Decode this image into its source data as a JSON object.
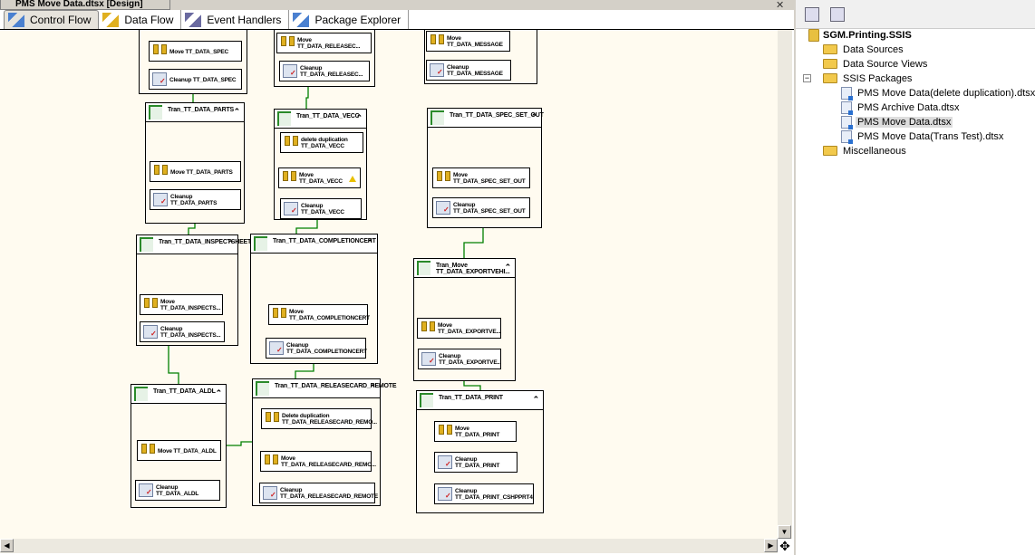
{
  "document_tab": "PMS Move Data.dtsx [Design]",
  "tabs": [
    {
      "label": "Control Flow",
      "icon": "control-flow-icon",
      "active": true
    },
    {
      "label": "Data Flow",
      "icon": "data-flow-icon",
      "active": false
    },
    {
      "label": "Event Handlers",
      "icon": "event-handlers-icon",
      "active": false
    },
    {
      "label": "Package Explorer",
      "icon": "package-explorer-icon",
      "active": false
    }
  ],
  "containers": [
    {
      "title": "",
      "tasks": [
        {
          "l1": "Move TT_DATA_SPEC",
          "l2": "",
          "type": "move"
        },
        {
          "l1": "Cleanup TT_DATA_SPEC",
          "l2": "",
          "type": "clean"
        }
      ]
    },
    {
      "title": "",
      "tasks": [
        {
          "l1": "Move",
          "l2": "TT_DATA_RELEASEC...",
          "type": "move"
        },
        {
          "l1": "Cleanup",
          "l2": "TT_DATA_RELEASEC...",
          "type": "clean"
        }
      ]
    },
    {
      "title": "",
      "tasks": [
        {
          "l1": "Move",
          "l2": "TT_DATA_MESSAGE",
          "type": "move"
        },
        {
          "l1": "Cleanup",
          "l2": "TT_DATA_MESSAGE",
          "type": "clean"
        }
      ]
    },
    {
      "title": "Tran_TT_DATA_PARTS",
      "tasks": [
        {
          "l1": "Move TT_DATA_PARTS",
          "l2": "",
          "type": "move"
        },
        {
          "l1": "Cleanup",
          "l2": "TT_DATA_PARTS",
          "type": "clean"
        }
      ]
    },
    {
      "title": "Tran_TT_DATA_VECC",
      "tasks": [
        {
          "l1": "delete duplication",
          "l2": "TT_DATA_VECC",
          "type": "move"
        },
        {
          "l1": "Move",
          "l2": "TT_DATA_VECC",
          "type": "move",
          "warning": true
        },
        {
          "l1": "Cleanup",
          "l2": "TT_DATA_VECC",
          "type": "clean"
        }
      ]
    },
    {
      "title": "Tran_TT_DATA_SPEC_SET_OUT",
      "tasks": [
        {
          "l1": "Move",
          "l2": "TT_DATA_SPEC_SET_OUT",
          "type": "move"
        },
        {
          "l1": "Cleanup",
          "l2": "TT_DATA_SPEC_SET_OUT",
          "type": "clean"
        }
      ]
    },
    {
      "title": "Tran_TT_DATA_INSPECTSHEET",
      "tasks": [
        {
          "l1": "Move",
          "l2": "TT_DATA_INSPECTS...",
          "type": "move"
        },
        {
          "l1": "Cleanup",
          "l2": "TT_DATA_INSPECTS...",
          "type": "clean"
        }
      ]
    },
    {
      "title": "Tran_TT_DATA_COMPLETIONCERT",
      "tasks": [
        {
          "l1": "Move",
          "l2": "TT_DATA_COMPLETIONCERT",
          "type": "move"
        },
        {
          "l1": "Cleanup",
          "l2": "TT_DATA_COMPLETIONCERT",
          "type": "clean"
        }
      ]
    },
    {
      "title": "Tran_Move TT_DATA_EXPORTVEHI...",
      "tasks": [
        {
          "l1": "Move",
          "l2": "TT_DATA_EXPORTVE...",
          "type": "move"
        },
        {
          "l1": "Cleanup",
          "l2": "TT_DATA_EXPORTVE...",
          "type": "clean"
        }
      ]
    },
    {
      "title": "Tran_TT_DATA_ALDL",
      "tasks": [
        {
          "l1": "Move TT_DATA_ALDL",
          "l2": "",
          "type": "move"
        },
        {
          "l1": "Cleanup",
          "l2": "TT_DATA_ALDL",
          "type": "clean"
        }
      ]
    },
    {
      "title": "Tran_TT_DATA_RELEASECARD_REMOTE",
      "tasks": [
        {
          "l1": "Delete duplication",
          "l2": "TT_DATA_RELEASECARD_REMO...",
          "type": "move"
        },
        {
          "l1": "Move",
          "l2": "TT_DATA_RELEASECARD_REMO...",
          "type": "move"
        },
        {
          "l1": "Cleanup",
          "l2": "TT_DATA_RELEASECARD_REMOTE",
          "type": "clean"
        }
      ]
    },
    {
      "title": "Tran_TT_DATA_PRINT",
      "tasks": [
        {
          "l1": "Move",
          "l2": "TT_DATA_PRINT",
          "type": "move"
        },
        {
          "l1": "Cleanup",
          "l2": "TT_DATA_PRINT",
          "type": "clean"
        },
        {
          "l1": "Cleanup",
          "l2": "TT_DATA_PRINT_CSHPPRT4",
          "type": "clean"
        }
      ]
    }
  ],
  "solution": {
    "project": "SGM.Printing.SSIS",
    "items": [
      {
        "label": "Data Sources",
        "kind": "folder"
      },
      {
        "label": "Data Source Views",
        "kind": "folder"
      },
      {
        "label": "SSIS Packages",
        "kind": "folder",
        "expanded": true
      },
      {
        "label": "PMS Move Data(delete duplication).dtsx",
        "kind": "package"
      },
      {
        "label": "PMS Archive Data.dtsx",
        "kind": "package"
      },
      {
        "label": "PMS Move Data.dtsx",
        "kind": "package",
        "selected": true
      },
      {
        "label": "PMS Move Data(Trans Test).dtsx",
        "kind": "package"
      },
      {
        "label": "Miscellaneous",
        "kind": "folder"
      }
    ]
  },
  "colors": {
    "canvas": "#fffbf0",
    "precedence": "#008000",
    "selection": "#dddddd"
  }
}
